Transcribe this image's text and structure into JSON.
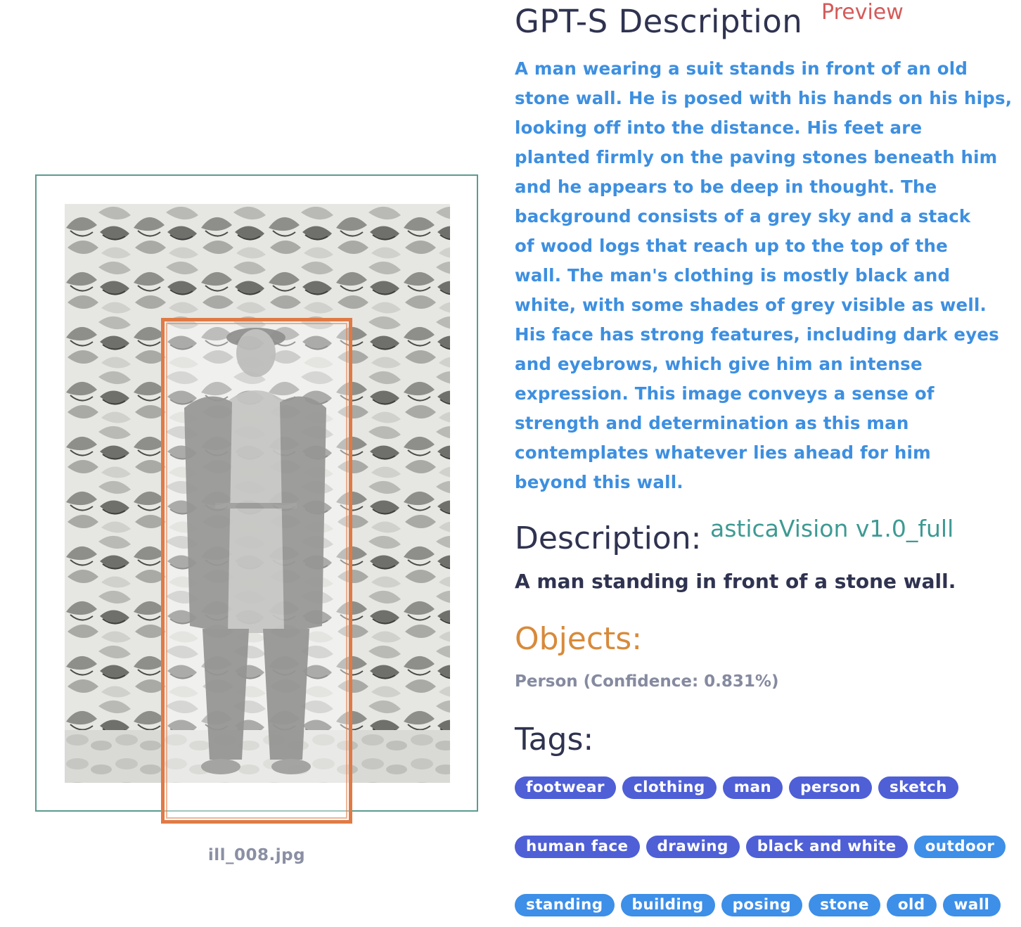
{
  "image": {
    "filename": "ill_008.jpg",
    "detections": [
      {
        "label": "Person"
      }
    ]
  },
  "gpt": {
    "heading": "GPT-S Description",
    "badge": "Preview",
    "lines": [
      "A man wearing a suit stands in front of an old",
      "stone wall. He is posed with his hands on his hips,",
      "looking off into the distance. His feet are",
      "planted firmly on the paving stones beneath him",
      "and he appears to be deep in thought. The",
      "background consists of a grey sky and a stack",
      "of wood logs that reach up to the top of the",
      "wall. The man's clothing is mostly black and",
      "white, with some shades of grey visible as well.",
      "His face has strong features, including dark eyes",
      "and eyebrows, which give him an intense",
      "expression. This image conveys a sense of",
      "strength and determination as this man",
      "contemplates whatever lies ahead for him",
      "beyond this wall."
    ]
  },
  "description": {
    "heading": "Description:",
    "model": "asticaVision v1.0_full",
    "text": "A man standing in front of a stone wall."
  },
  "objects": {
    "heading": "Objects:",
    "items": [
      "Person (Confidence: 0.831%)"
    ]
  },
  "tags": {
    "heading": "Tags:",
    "rows": [
      [
        "footwear",
        "clothing",
        "man",
        "person",
        "sketch"
      ],
      [
        "human face",
        "drawing",
        "black and white",
        "outdoor"
      ],
      [
        "standing",
        "building",
        "posing",
        "stone",
        "old",
        "wall"
      ]
    ]
  },
  "colors": {
    "frame": "#5b9b8f",
    "bbox": "#e07a45",
    "gpt_text": "#3d8fe0",
    "preview": "#d45a5a",
    "model": "#3e9a93",
    "objects_heading": "#d88a3a",
    "tag_dark": "#4f5fd6",
    "tag_light": "#3d8fe8"
  }
}
